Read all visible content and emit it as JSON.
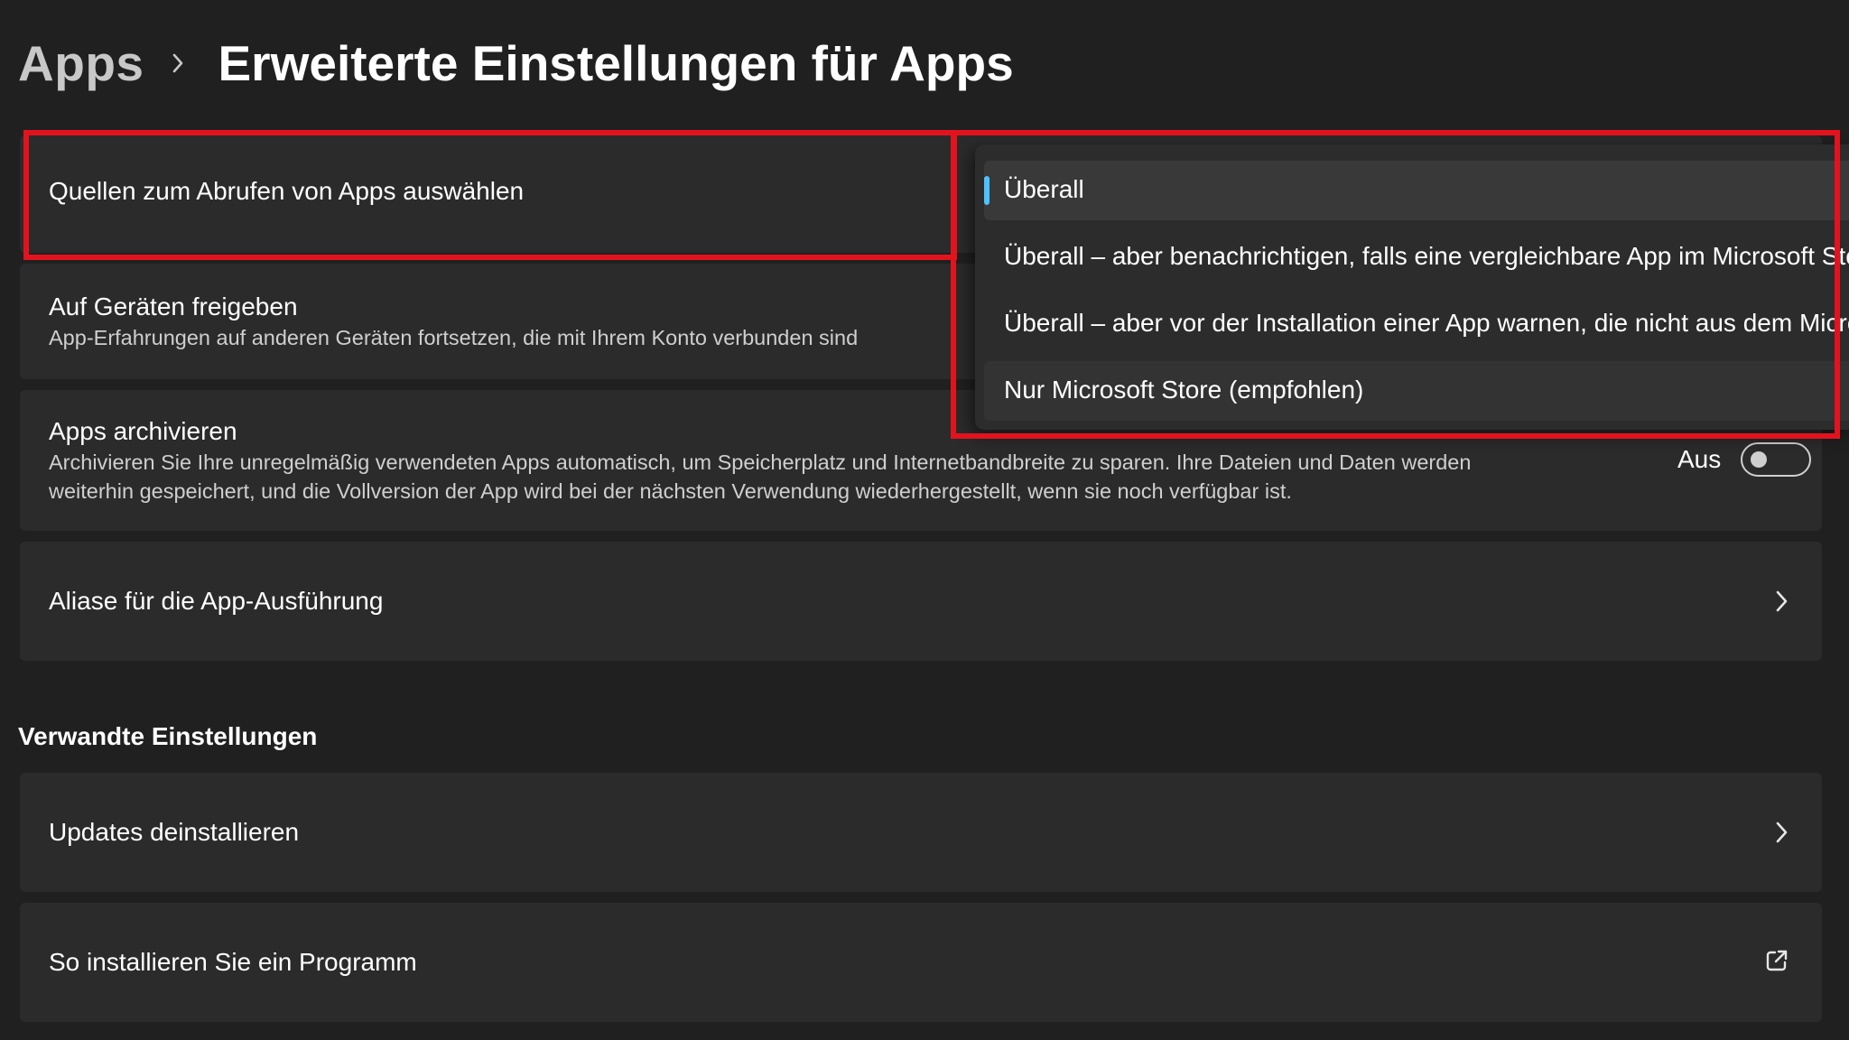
{
  "header": {
    "breadcrumb_root": "Apps",
    "title": "Erweiterte Einstellungen für Apps"
  },
  "settings": {
    "sources": {
      "title": "Quellen zum Abrufen von Apps auswählen"
    },
    "share": {
      "title": "Auf Geräten freigeben",
      "description": "App-Erfahrungen auf anderen Geräten fortsetzen, die mit Ihrem Konto verbunden sind"
    },
    "archive": {
      "title": "Apps archivieren",
      "description_line1": "Archivieren Sie Ihre unregelmäßig verwendeten Apps automatisch, um Speicherplatz und Internetbandbreite zu sparen. Ihre Dateien und Daten werden",
      "description_line2": "weiterhin gespeichert, und die Vollversion der App wird bei der nächsten Verwendung wiederhergestellt, wenn sie noch verfügbar ist.",
      "toggle_label": "Aus",
      "toggle_on": false
    },
    "alias": {
      "title": "Aliase für die App-Ausführung"
    }
  },
  "related": {
    "heading": "Verwandte Einstellungen",
    "updates": {
      "title": "Updates deinstallieren"
    },
    "install": {
      "title": "So installieren Sie ein Programm"
    }
  },
  "dropdown": {
    "selected_index": 0,
    "options": [
      "Überall",
      "Überall – aber benachrichtigen, falls eine vergleichbare App im Microsoft Sto",
      "Überall – aber vor der Installation einer App warnen, die nicht aus dem Micro",
      "Nur Microsoft Store (empfohlen)"
    ]
  },
  "colors": {
    "background": "#202020",
    "card": "#2b2b2b",
    "accent": "#4cc2ff",
    "annotation": "#e3131e"
  },
  "icons": [
    "chevron-right-icon",
    "external-link-icon"
  ]
}
